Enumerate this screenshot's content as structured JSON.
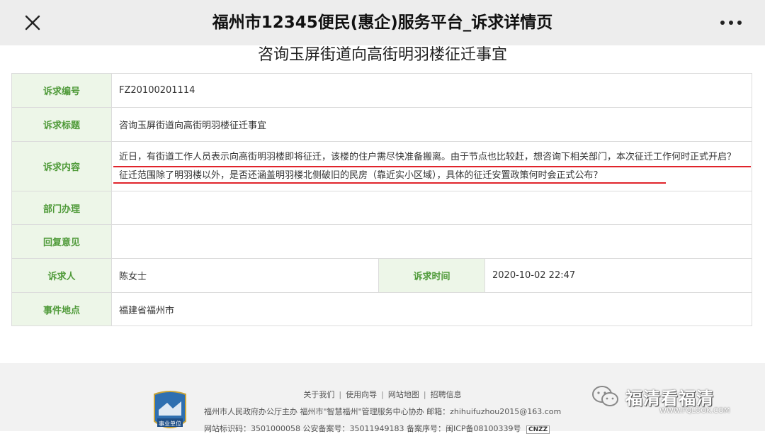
{
  "nav": {
    "title": "福州市12345便民(惠企)服务平台_诉求详情页"
  },
  "page": {
    "heading": "咨询玉屏街道向高街明羽楼征迁事宜"
  },
  "detail": {
    "rows": [
      {
        "label": "诉求编号",
        "value": "FZ20100201114"
      },
      {
        "label": "诉求标题",
        "value": "咨询玉屏街道向高街明羽楼征迁事宜"
      },
      {
        "label": "诉求内容",
        "value": "近日，有街道工作人员表示向高街明羽楼即将征迁，该楼的住户需尽快准备搬离。由于节点也比较赶，想咨询下相关部门，本次征迁工作何时正式开启？征迁范围除了明羽楼以外，是否还涵盖明羽楼北侧破旧的民房（靠近实小区域），具体的征迁安置政策何时会正式公布？"
      },
      {
        "label": "部门办理",
        "value": ""
      },
      {
        "label": "回复意见",
        "value": ""
      }
    ],
    "requester_label": "诉求人",
    "requester_value": "陈女士",
    "time_label": "诉求时间",
    "time_value": "2020-10-02 22:47",
    "location_label": "事件地点",
    "location_value": "福建省福州市"
  },
  "footer": {
    "links": [
      "关于我们",
      "使用向导",
      "网站地图",
      "招聘信息"
    ],
    "line1": "福州市人民政府办公厅主办 福州市\"智慧福州\"管理服务中心协办 邮箱：zhihuifuzhou2015@163.com",
    "line2": "网站标识码：3501000058  公安备案号：35011949183  备案序号：闽ICP备08100339号",
    "badge_text": "事业单位",
    "cnzz_text": "CNZZ"
  },
  "watermark": {
    "text": "福清看福清",
    "url": "WWW.FQLOOK.COM"
  },
  "colors": {
    "label_bg": "#edf6e8",
    "label_text": "#4f9a39",
    "underline": "#e0242b"
  }
}
